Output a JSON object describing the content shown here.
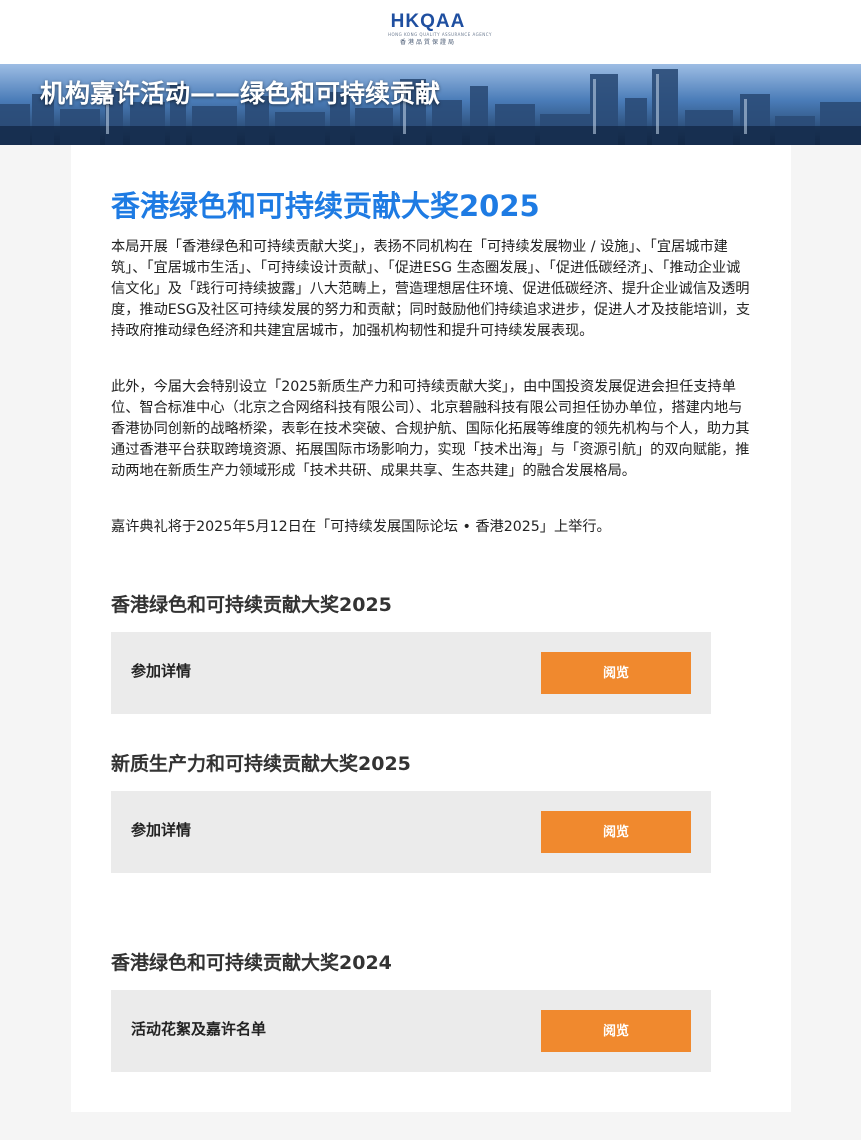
{
  "header": {
    "logo_text": "HKQAA",
    "logo_sub": "HONG KONG QUALITY ASSURANCE AGENCY",
    "logo_cn": "香港品質保證局"
  },
  "banner": {
    "title": "机构嘉许活动——绿色和可持续贡献"
  },
  "main": {
    "title": "香港绿色和可持续贡献大奖2025",
    "paragraph1": "本局开展「香港绿色和可持续贡献大奖」，表扬不同机构在「可持续发展物业 / 设施」、「宜居城市建筑」、「宜居城市生活」、「可持续设计贡献」、「促进ESG 生态圈发展」、「促进低碳经济」、「推动企业诚信文化」及「践行可持续披露」八大范畴上，营造理想居住环境、促进低碳经济、提升企业诚信及透明度，推动ESG及社区可持续发展的努力和贡献；同时鼓励他们持续追求进步，促进人才及技能培训，支持政府推动绿色经济和共建宜居城市，加强机构韧性和提升可持续发展表现。",
    "paragraph2": "此外，今届大会特别设立「2025新质生产力和可持续贡献大奖」，由中国投资发展促进会担任支持单位、智合标准中心（北京之合网络科技有限公司）、北京碧融科技有限公司担任协办单位，搭建内地与香港协同创新的战略桥梁，表彰在技术突破、合规护航、国际化拓展等维度的领先机构与个人，助力其通过香港平台获取跨境资源、拓展国际市场影响力，实现「技术出海」与「资源引航」的双向赋能，推动两地在新质生产力领域形成「技术共研、成果共享、生态共建」的融合发展格局。",
    "paragraph3": "嘉许典礼将于2025年5月12日在「可持续发展国际论坛 • 香港2025」上举行。"
  },
  "sections": [
    {
      "title": "香港绿色和可持续贡献大奖2025",
      "label": "参加详情",
      "button": "阅览"
    },
    {
      "title": "新质生产力和可持续贡献大奖2025",
      "label": "参加详情",
      "button": "阅览"
    },
    {
      "title": "香港绿色和可持续贡献大奖2024",
      "label": "活动花絮及嘉许名单",
      "button": "阅览"
    }
  ],
  "colors": {
    "title_blue": "#1e7be3",
    "button_orange": "#f0892e",
    "box_grey": "#ebebeb"
  }
}
